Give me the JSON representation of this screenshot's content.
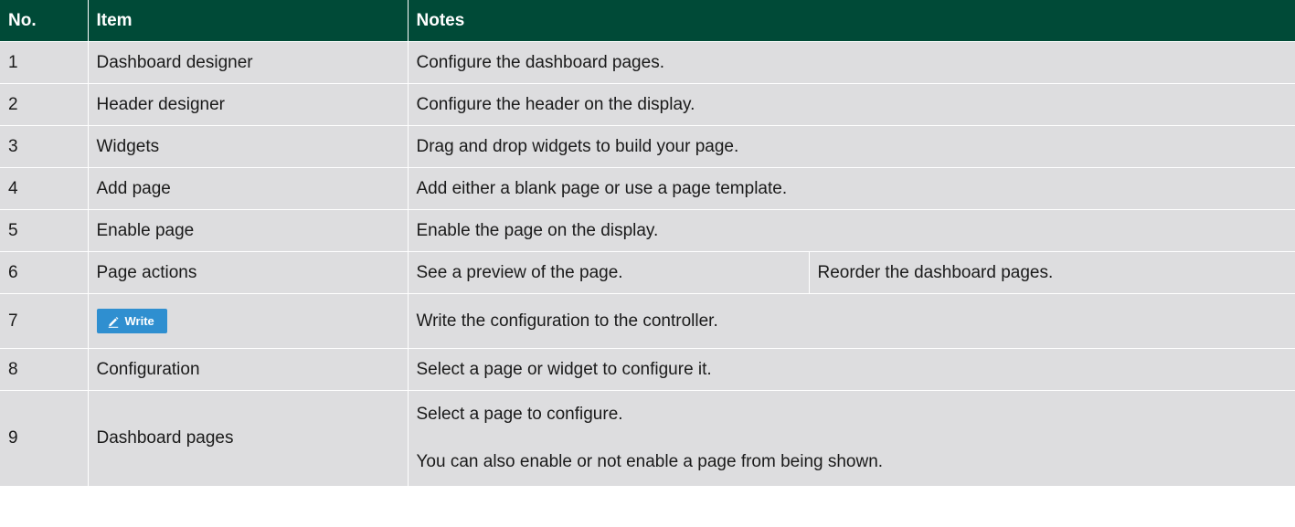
{
  "headers": {
    "no": "No.",
    "item": "Item",
    "notes": "Notes"
  },
  "rows": [
    {
      "no": "1",
      "item": "Dashboard designer",
      "notes": "Configure the dashboard pages."
    },
    {
      "no": "2",
      "item": "Header designer",
      "notes": "Configure the header on the display."
    },
    {
      "no": "3",
      "item": "Widgets",
      "notes": "Drag and drop widgets to build your page."
    },
    {
      "no": "4",
      "item": "Add page",
      "notes": "Add either a blank page or use a page template."
    },
    {
      "no": "5",
      "item": "Enable page",
      "notes": "Enable the page on the display."
    },
    {
      "no": "6",
      "item": "Page actions",
      "notes": "See a preview of the page.",
      "notes_extra": "Reorder the dashboard pages."
    },
    {
      "no": "7",
      "item_button": "Write",
      "item_icon": "pencil-icon",
      "notes": "Write the configuration to the controller."
    },
    {
      "no": "8",
      "item": "Configuration",
      "notes": "Select a page or widget to configure it."
    },
    {
      "no": "9",
      "item": "Dashboard pages",
      "notes": "Select a page to configure.",
      "notes_extra": "You can also enable or not enable a page from being shown."
    }
  ],
  "colors": {
    "header_bg": "#004a37",
    "row_bg": "#dddddf",
    "button_bg": "#2f8fd0"
  }
}
